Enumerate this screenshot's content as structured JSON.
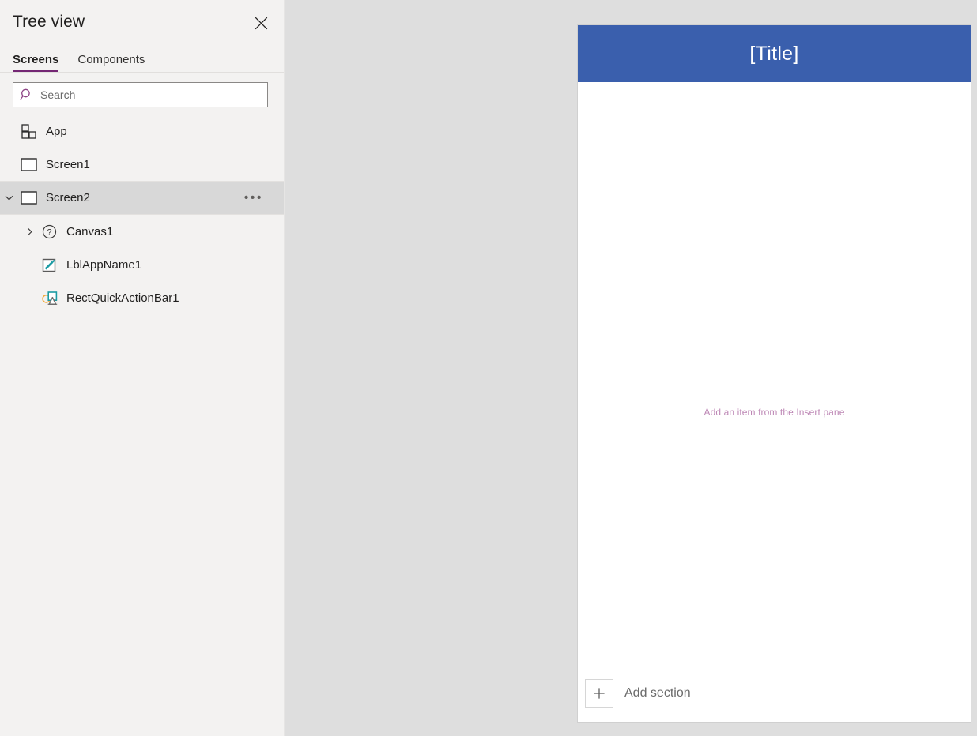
{
  "tree_view": {
    "title": "Tree view",
    "close_icon": "close-icon",
    "tabs": [
      {
        "label": "Screens",
        "active": true
      },
      {
        "label": "Components",
        "active": false
      }
    ],
    "search": {
      "placeholder": "Search",
      "value": "",
      "icon": "search-icon"
    },
    "items": [
      {
        "label": "App",
        "icon": "app-grid-icon",
        "indent": 0,
        "chevron": "none",
        "selected": false,
        "divider": true,
        "more": false
      },
      {
        "label": "Screen1",
        "icon": "screen-rect-icon",
        "indent": 0,
        "chevron": "none",
        "selected": false,
        "divider": true,
        "more": false
      },
      {
        "label": "Screen2",
        "icon": "screen-rect-icon",
        "indent": 0,
        "chevron": "down",
        "selected": true,
        "divider": true,
        "more": true
      },
      {
        "label": "Canvas1",
        "icon": "question-circle-icon",
        "indent": 1,
        "chevron": "right",
        "selected": false,
        "divider": false,
        "more": false
      },
      {
        "label": "LblAppName1",
        "icon": "label-pencil-icon",
        "indent": 1,
        "chevron": "none",
        "selected": false,
        "divider": false,
        "more": false
      },
      {
        "label": "RectQuickActionBar1",
        "icon": "shapes-icon",
        "indent": 1,
        "chevron": "none",
        "selected": false,
        "divider": false,
        "more": false
      }
    ],
    "more_menu_glyph": "•••"
  },
  "screen_preview": {
    "title": "[Title]",
    "placeholder_text": "Add an item from the Insert pane",
    "add_section": {
      "label": "Add section",
      "icon": "plus-icon"
    }
  },
  "colors": {
    "accent_purple": "#742774",
    "title_bar_blue": "#3a5fad",
    "panel_background": "#f3f2f1",
    "canvas_background": "#dedede",
    "selected_row": "#d8d8d8",
    "placeholder_mauve": "#bd87b5"
  }
}
